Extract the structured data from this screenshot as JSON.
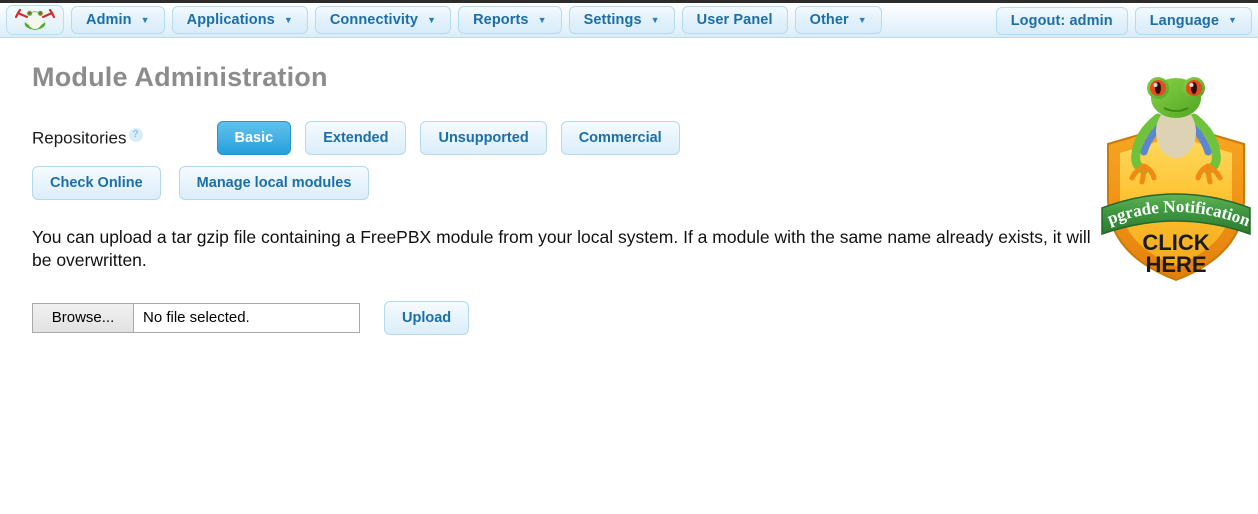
{
  "nav": {
    "logo_icon": "freepbx-frog-logo",
    "items": [
      {
        "label": "Admin",
        "has_caret": true
      },
      {
        "label": "Applications",
        "has_caret": true
      },
      {
        "label": "Connectivity",
        "has_caret": true
      },
      {
        "label": "Reports",
        "has_caret": true
      },
      {
        "label": "Settings",
        "has_caret": true
      },
      {
        "label": "User Panel",
        "has_caret": false
      },
      {
        "label": "Other",
        "has_caret": true
      }
    ],
    "right_items": [
      {
        "label": "Logout: admin",
        "has_caret": false
      },
      {
        "label": "Language",
        "has_caret": true
      }
    ],
    "caret_glyph": "▼"
  },
  "page": {
    "title": "Module Administration",
    "repositories_label": "Repositories",
    "help_icon_glyph": "?",
    "repo_tabs": [
      {
        "label": "Basic",
        "active": true
      },
      {
        "label": "Extended",
        "active": false
      },
      {
        "label": "Unsupported",
        "active": false
      },
      {
        "label": "Commercial",
        "active": false
      }
    ],
    "actions": [
      {
        "label": "Check Online"
      },
      {
        "label": "Manage local modules"
      }
    ],
    "intro_text": "You can upload a tar gzip file containing a FreePBX module from your local system. If a module with the same name already exists, it will be overwritten.",
    "upload": {
      "browse_label": "Browse...",
      "file_status": "No file selected.",
      "upload_label": "Upload"
    }
  },
  "badge": {
    "banner_text": "Upgrade Notifications",
    "cta_line1": "CLICK",
    "cta_line2": "HERE",
    "frog_icon": "tree-frog-icon"
  },
  "colors": {
    "accent_blue": "#23a0dc",
    "nav_text": "#1b6ea8",
    "title_gray": "#8c8c8c",
    "badge_gold": "#f5a623",
    "badge_green": "#3f9b43"
  }
}
